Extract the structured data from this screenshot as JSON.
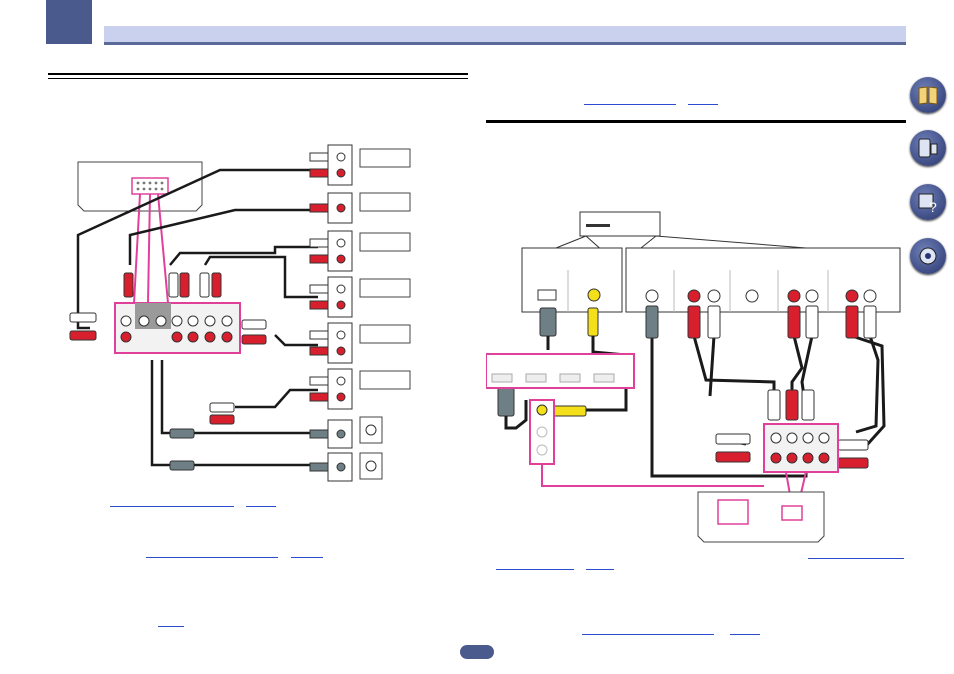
{
  "page": {
    "chapter_tab": "",
    "header_title": "",
    "page_number": ""
  },
  "nav": {
    "icons": [
      "manual-book-icon",
      "settings-remote-icon",
      "faq-icon",
      "system-setup-icon"
    ]
  },
  "colors": {
    "accent": "#4a5a8c",
    "header_bg": "#c9d1ef",
    "link": "#2b4bd0",
    "highlight": "#e0409a",
    "plug_red": "#d81f2e",
    "plug_white": "#ffffff",
    "plug_yellow": "#f4e01a",
    "plug_gray": "#6e7f86",
    "cable": "#1a1a1a"
  },
  "left_diagram": {
    "source_devices": [
      "audio-device-1",
      "audio-device-2",
      "audio-device-3",
      "audio-device-4",
      "audio-device-5",
      "audio-device-6"
    ],
    "speakers": [
      "subwoofer-1",
      "subwoofer-2"
    ]
  },
  "right_diagram": {
    "player": "bd-player",
    "jack_groups": [
      "hdmi-out",
      "video-out",
      "audio-out-1",
      "audio-out-2",
      "audio-out-3",
      "audio-out-4",
      "audio-out-5"
    ]
  }
}
